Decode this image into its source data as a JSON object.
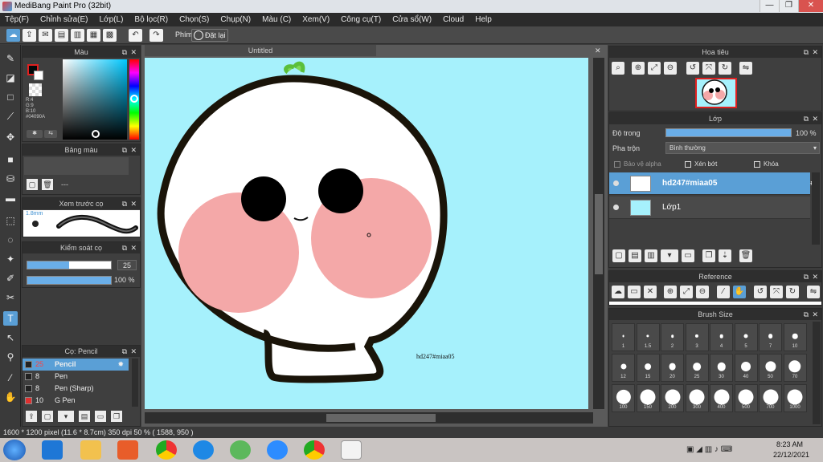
{
  "window": {
    "title": "MediBang Paint Pro (32bit)",
    "min": "—",
    "restore": "❐",
    "close": "✕"
  },
  "menu": [
    "Tệp(F)",
    "Chỉnh sửa(E)",
    "Lớp(L)",
    "Bộ lọc(R)",
    "Chọn(S)",
    "Chụp(N)",
    "Màu (C)",
    "Xem(V)",
    "Công cụ(T)",
    "Cửa sổ(W)",
    "Cloud",
    "Help"
  ],
  "toolbar": {
    "phim_label": "Phím",
    "reset_label": "Đặt lại"
  },
  "color_panel": {
    "title": "Màu",
    "r": "R:4",
    "g": "G:9",
    "b": "B:10",
    "hex": "#04090A",
    "fg": "#04090a",
    "bg": "#ffffff"
  },
  "palette_panel": {
    "title": "Bảng màu",
    "dash": "---"
  },
  "preview_panel": {
    "title": "Xem trước cọ",
    "size": "1.8mm"
  },
  "control_panel": {
    "title": "Kiểm soát cọ",
    "size_value": "25",
    "opacity_value": "100 %",
    "size_fill": 0.5,
    "opacity_fill": 1.0
  },
  "brush_panel": {
    "title": "Cọ: Pencil",
    "items": [
      {
        "num": "25",
        "name": "Pencil",
        "selected": true,
        "color": "#222222"
      },
      {
        "num": "8",
        "name": "Pen",
        "selected": false,
        "color": "#222222"
      },
      {
        "num": "8",
        "name": "Pen (Sharp)",
        "selected": false,
        "color": "#222222"
      },
      {
        "num": "10",
        "name": "G Pen",
        "selected": false,
        "color": "#e03030"
      }
    ]
  },
  "canvas": {
    "tab": "Untitled",
    "watermark": "hd247#miaa05",
    "bg_color": "#a6f1fc"
  },
  "navigator": {
    "title": "Hoa tiêu"
  },
  "layer_panel": {
    "title": "Lớp",
    "opacity_label": "Độ trong",
    "opacity_value": "100 %",
    "opacity_fill": 1.0,
    "blend_label": "Pha trộn",
    "blend_value": "Bình thường",
    "protect_alpha": "Bảo vệ alpha",
    "clipping": "Xén bớt",
    "lock": "Khóa",
    "layers": [
      {
        "name": "hd247#miaa05",
        "selected": true
      },
      {
        "name": "Lớp1",
        "selected": false
      }
    ]
  },
  "reference_panel": {
    "title": "Reference"
  },
  "brush_size_panel": {
    "title": "Brush Size",
    "sizes": [
      "1",
      "1.5",
      "2",
      "3",
      "4",
      "5",
      "7",
      "10",
      "12",
      "15",
      "20",
      "25",
      "30",
      "40",
      "50",
      "70",
      "100",
      "150",
      "200",
      "300",
      "400",
      "500",
      "700",
      "1000"
    ]
  },
  "status": {
    "text": "1600 * 1200 pixel   (11.6 * 8.7cm)   350 dpi   50 %   ( 1588, 950 )"
  },
  "taskbar": {
    "time": "8:23 AM",
    "date": "22/12/2021"
  }
}
